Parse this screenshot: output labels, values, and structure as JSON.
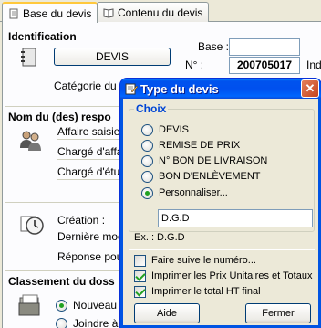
{
  "tabs": [
    {
      "label": "Base du devis",
      "active": true
    },
    {
      "label": "Contenu du devis",
      "active": false
    }
  ],
  "background": {
    "identification_title": "Identification",
    "devis_button": "DEVIS",
    "base_label": "Base :",
    "base_value": "",
    "number_label": "N° :",
    "number_value": "200705017",
    "indice_label": "Indi",
    "categorie_label": "Catégorie du de",
    "responsables_title": "Nom du (des) respo",
    "affaire_label": "Affaire saisie p",
    "charge_affaire_label": "Chargé d'affair",
    "charge_etude_label": "Chargé d'étude",
    "creation_label": "Création :",
    "derniere_modif_label": "Dernière modifi",
    "reponse_label": "Réponse pour",
    "classement_title": "Classement du doss",
    "nouveau_label": "Nouveau n",
    "joindre_label": "Joindre à u"
  },
  "dialog": {
    "title": "Type du devis",
    "close_label": "✕",
    "group_label": "Choix",
    "options": [
      {
        "label": "DEVIS",
        "checked": false
      },
      {
        "label": "REMISE DE PRIX",
        "checked": false
      },
      {
        "label": "N° BON DE LIVRAISON",
        "checked": false
      },
      {
        "label": "BON D'ENLÈVEMENT",
        "checked": false
      },
      {
        "label": "Personnaliser...",
        "checked": true
      }
    ],
    "custom_value": "D.G.D",
    "example_text": "Ex. : D.G.D",
    "checkboxes": [
      {
        "label": "Faire suive le numéro...",
        "checked": false
      },
      {
        "label": "Imprimer les Prix Unitaires et Totaux",
        "checked": true
      },
      {
        "label": "Imprimer le total HT final",
        "checked": true
      }
    ],
    "help_button": "Aide",
    "close_button": "Fermer"
  },
  "colors": {
    "titlebar": "#0054e3",
    "group_label": "#0046d5",
    "check_mark": "#21a121"
  }
}
